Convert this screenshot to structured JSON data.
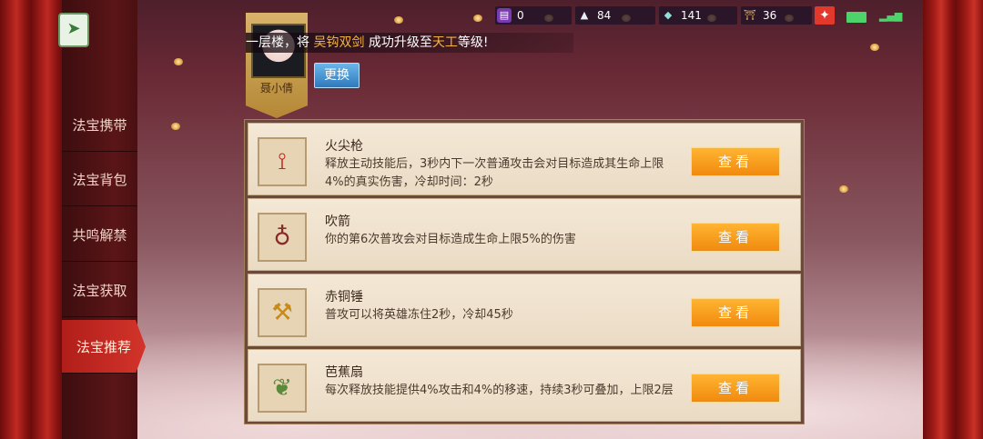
{
  "resources": [
    {
      "icon": "book-icon",
      "value": "0"
    },
    {
      "icon": "silver-icon",
      "value": "84"
    },
    {
      "icon": "gem-icon",
      "value": "141"
    },
    {
      "icon": "gate-icon",
      "value": "36"
    }
  ],
  "sidebar": {
    "items": [
      {
        "label": "法宝携带"
      },
      {
        "label": "法宝背包"
      },
      {
        "label": "共鸣解禁"
      },
      {
        "label": "法宝获取"
      },
      {
        "label": "法宝推荐"
      }
    ]
  },
  "announcement": {
    "prefix": "一层楼，将",
    "item": "吴钩双剑",
    "middle": "成功升级至",
    "level": "天工",
    "suffix": "等级!"
  },
  "hero": {
    "name": "聂小倩",
    "swap_label": "更换"
  },
  "treasures": [
    {
      "name": "火尖枪",
      "icon": "spear-icon",
      "desc": "释放主动技能后，3秒内下一次普通攻击会对目标造成其生命上限4%的真实伤害，冷却时间：2秒",
      "button": "查看"
    },
    {
      "name": "吹箭",
      "icon": "pouch-icon",
      "desc": "你的第6次普攻会对目标造成生命上限5%的伤害",
      "button": "查看"
    },
    {
      "name": "赤铜锤",
      "icon": "hammer-icon",
      "desc": "普攻可以将英雄冻住2秒，冷却45秒",
      "button": "查看"
    },
    {
      "name": "芭蕉扇",
      "icon": "fan-icon",
      "desc": "每次释放技能提供4%攻击和4%的移速，持续3秒可叠加，上限2层",
      "button": "查看"
    }
  ]
}
